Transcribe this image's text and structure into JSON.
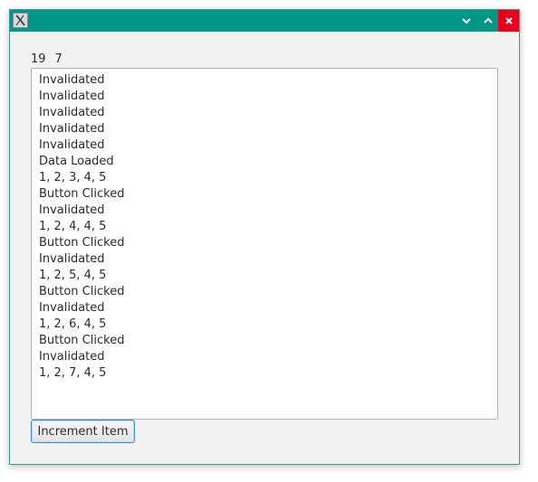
{
  "window": {
    "titlebar_color": "#009688",
    "close_color": "#e8001c",
    "icons": {
      "app": "x-app-icon",
      "minimize": "chevron-down-icon",
      "maximize": "chevron-up-icon",
      "close": "close-icon"
    }
  },
  "counters": {
    "first": "19",
    "second": "7"
  },
  "log": {
    "lines": [
      "Invalidated",
      "Invalidated",
      "Invalidated",
      "Invalidated",
      "Invalidated",
      "Data Loaded",
      "1, 2, 3, 4, 5",
      "Button Clicked",
      "Invalidated",
      "1, 2, 4, 4, 5",
      "Button Clicked",
      "Invalidated",
      "1, 2, 5, 4, 5",
      "Button Clicked",
      "Invalidated",
      "1, 2, 6, 4, 5",
      "Button Clicked",
      "Invalidated",
      "1, 2, 7, 4, 5"
    ]
  },
  "actions": {
    "increment_label": "Increment Item"
  }
}
